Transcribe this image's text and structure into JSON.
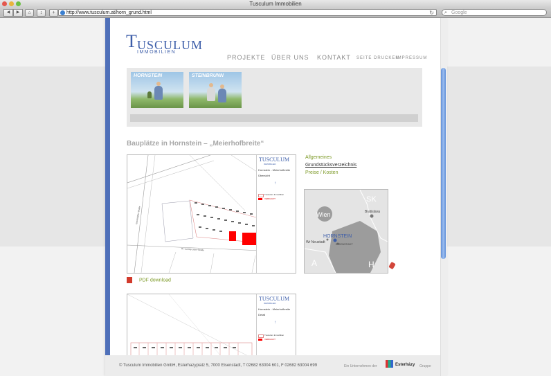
{
  "window": {
    "title": "Tusculum Immobilien"
  },
  "toolbar": {
    "url": "http://www.tusculum.at/horn_grund.html",
    "search_placeholder": "Google"
  },
  "site": {
    "logo": {
      "initial": "T",
      "word": "USCULUM",
      "sub": "IMMOBILIEN"
    },
    "nav": [
      "PROJEKTE",
      "ÜBER UNS",
      "KONTAKT"
    ],
    "nav_small": [
      "SEITE DRUCKEN",
      "IMPRESSUM"
    ],
    "thumbs": [
      "HORNSTEIN",
      "STEINBRUNN"
    ],
    "heading": "Bauplätze in Hornstein – „Meierhofbreite“",
    "links": [
      "Allgemeines",
      "Grundstücksverzeichnis",
      "Preise / Kosten"
    ],
    "map": {
      "city_big": "Wien",
      "region": "SK",
      "city_a": "Bratislava",
      "city_b": "Wr Neustadt",
      "place": "HORNSTEIN",
      "place_sub": "EISENSTADT",
      "country_a": "A",
      "country_h": "H"
    },
    "plan1": {
      "logo": "TUSCULUM",
      "logo_sub": "IMMOBILIEN",
      "line1": "Hornstein - Meierhofbreite",
      "line2": "Übersicht",
      "legend1": "Tusculum Immobilien",
      "legend2": "VERKAUFT",
      "street": "Dr.-Ludwig-Leser-Straße",
      "road": "Eisenstädter Straße"
    },
    "plan2": {
      "logo": "TUSCULUM",
      "logo_sub": "IMMOBILIEN",
      "line1": "Hornstein - Meierhofbreite",
      "line2": "Detail",
      "legend1": "Tusculum Immobilien",
      "legend2": "VERKAUFT"
    },
    "pdf": "PDF download",
    "footer": "© Tusculum Immobilien GmbH, Esterhazyplatz 5, 7000 Eisenstadt, T 02682 63004 601, F 02682 63004 699",
    "footer_right_a": "Ein Unternehmen der",
    "footer_brand": "Esterházy",
    "footer_right_b": "Gruppe"
  },
  "colors": {
    "accent_blue": "#4f70b9",
    "link_green": "#7d9a27",
    "sold_red": "#ff0000"
  }
}
